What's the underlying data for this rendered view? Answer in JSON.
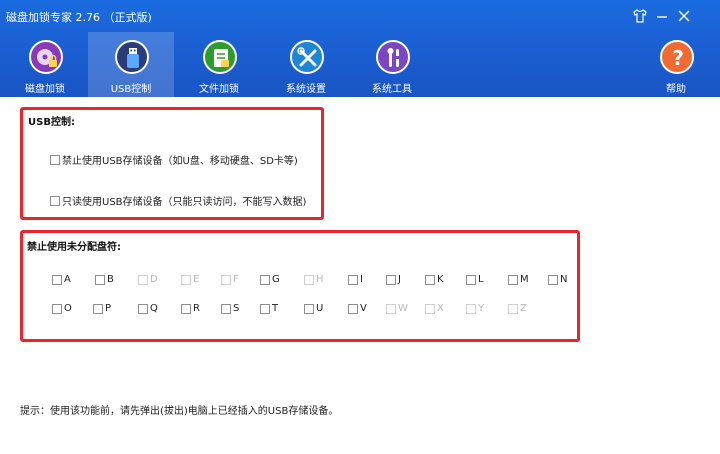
{
  "window": {
    "title": "磁盘加锁专家 2.76 （正式版)",
    "controls": [
      "shirt-icon",
      "minimize-icon",
      "close-icon"
    ]
  },
  "nav": [
    {
      "label": "磁盘加锁",
      "icon": "disk-lock-icon",
      "active": false
    },
    {
      "label": "USB控制",
      "icon": "usb-icon",
      "active": true
    },
    {
      "label": "文件加锁",
      "icon": "file-lock-icon",
      "active": false
    },
    {
      "label": "系统设置",
      "icon": "tools-icon",
      "active": false
    },
    {
      "label": "系统工具",
      "icon": "toolbox-icon",
      "active": false
    },
    {
      "label": "帮助",
      "icon": "help-icon",
      "active": false
    }
  ],
  "usb": {
    "title": "USB控制:",
    "options": [
      {
        "label": "禁止使用USB存储设备（如U盘、移动硬盘、SD卡等)",
        "checked": false
      },
      {
        "label": "只读使用USB存储设备（只能只读访问，不能写入数据)",
        "checked": false
      }
    ]
  },
  "drives": {
    "title": "禁止使用未分配盘符:",
    "row1": [
      {
        "letter": "A",
        "disabled": false
      },
      {
        "letter": "B",
        "disabled": false
      },
      {
        "letter": "D",
        "disabled": true
      },
      {
        "letter": "E",
        "disabled": true
      },
      {
        "letter": "F",
        "disabled": true
      },
      {
        "letter": "G",
        "disabled": false
      },
      {
        "letter": "H",
        "disabled": true
      },
      {
        "letter": "I",
        "disabled": false
      },
      {
        "letter": "J",
        "disabled": false
      },
      {
        "letter": "K",
        "disabled": false
      },
      {
        "letter": "L",
        "disabled": false
      },
      {
        "letter": "M",
        "disabled": false
      },
      {
        "letter": "N",
        "disabled": false
      }
    ],
    "row2": [
      {
        "letter": "O",
        "disabled": false
      },
      {
        "letter": "P",
        "disabled": false
      },
      {
        "letter": "Q",
        "disabled": false
      },
      {
        "letter": "R",
        "disabled": false
      },
      {
        "letter": "S",
        "disabled": false
      },
      {
        "letter": "T",
        "disabled": false
      },
      {
        "letter": "U",
        "disabled": false
      },
      {
        "letter": "V",
        "disabled": false
      },
      {
        "letter": "W",
        "disabled": true
      },
      {
        "letter": "X",
        "disabled": true
      },
      {
        "letter": "Y",
        "disabled": true
      },
      {
        "letter": "Z",
        "disabled": true
      }
    ]
  },
  "hint": "提示：使用该功能前，请先弹出(拔出)电脑上已经插入的USB存储设备。",
  "colors": {
    "header": "#1b5fd2",
    "highlight_border": "#e8262c",
    "nav_disk": "#8a3ab9",
    "nav_usb": "#2a3d7a",
    "nav_file": "#2e9b2e",
    "nav_settings": "#1d86d6",
    "nav_tools": "#7a46c2",
    "nav_help": "#f26a32"
  }
}
